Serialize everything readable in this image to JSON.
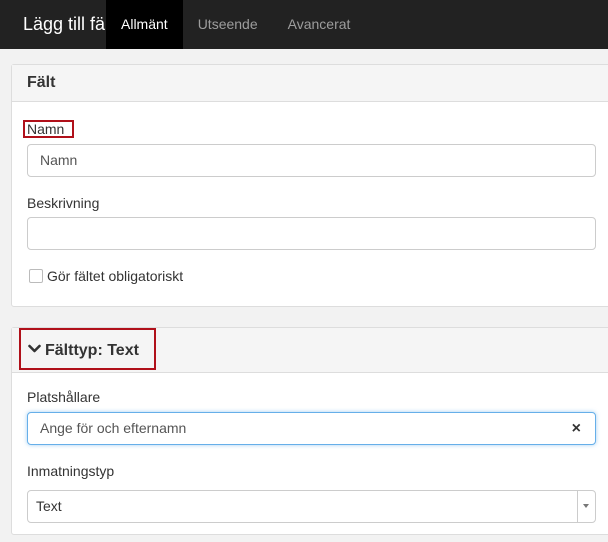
{
  "header": {
    "title": "Lägg till fält",
    "tabs": [
      {
        "label": "Allmänt",
        "active": true
      },
      {
        "label": "Utseende",
        "active": false
      },
      {
        "label": "Avancerat",
        "active": false
      }
    ]
  },
  "field_panel": {
    "title": "Fält",
    "name_label": "Namn",
    "name_value": "Namn",
    "description_label": "Beskrivning",
    "description_value": "",
    "required_label": "Gör fältet obligatoriskt",
    "required_checked": false
  },
  "fieldtype_panel": {
    "icon": "chevron-down-icon",
    "title": "Fälttyp: Text",
    "placeholder_label": "Platshållare",
    "placeholder_value": "Ange för och efternamn",
    "clear_icon": "×",
    "input_type_label": "Inmatningstyp",
    "input_type_value": "Text"
  },
  "colors": {
    "highlight": "#b0101a",
    "topbar": "#222222",
    "focus_border": "#66afe9"
  }
}
